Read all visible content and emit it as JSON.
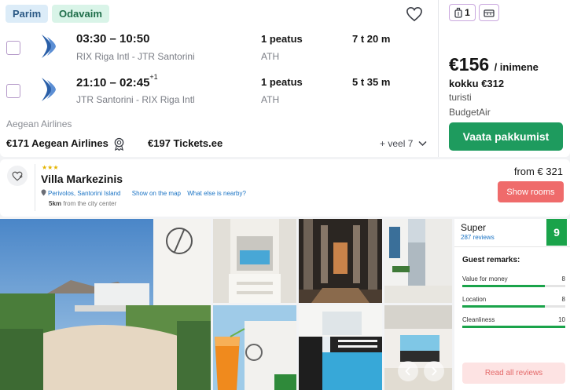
{
  "flight": {
    "badges": {
      "best": "Parim",
      "cheapest": "Odavaim"
    },
    "outbound": {
      "times": "03:30 – 10:50",
      "day_offset": "",
      "route": "RIX Riga Intl - JTR Santorini",
      "stops": "1 peatus",
      "via": "ATH",
      "duration": "7 t 20 m"
    },
    "inbound": {
      "times": "21:10 – 02:45",
      "day_offset": "+1",
      "route": "JTR Santorini - RIX Riga Intl",
      "stops": "1 peatus",
      "via": "ATH",
      "duration": "5 t 35 m"
    },
    "airline": "Aegean Airlines",
    "alternatives": [
      {
        "price": "€171",
        "provider": "Aegean Airlines"
      },
      {
        "price": "€197",
        "provider": "Tickets.ee"
      }
    ],
    "more_label": "+ veel 7",
    "baggage_count": "1",
    "price": "€156",
    "per_person": "/ inimene",
    "total_label": "kokku",
    "total_value": "€312",
    "cabin": "turisti",
    "provider": "BudgetAir",
    "cta_label": "Vaata pakkumist",
    "colors": {
      "cta": "#1e9b5e",
      "accent": "#b59ac9",
      "badge_best": "#dcecf8",
      "badge_cheap": "#d9f4e8"
    }
  },
  "hotel": {
    "stars": "★★★",
    "name": "Villa Markezinis",
    "location": "Perivolos, Santorini Island",
    "map_link": "Show on the map",
    "nearby_link": "What else is nearby?",
    "distance_value": "5km",
    "distance_label": "from the city center",
    "from_label": "from € 321",
    "show_rooms_label": "Show rooms",
    "rating_word": "Super",
    "review_count": "287 reviews",
    "score": "9",
    "remarks_title": "Guest remarks:",
    "metrics": [
      {
        "label": "Value for money",
        "value": "8",
        "fill": 0.8
      },
      {
        "label": "Location",
        "value": "8",
        "fill": 0.8
      },
      {
        "label": "Cleanliness",
        "value": "10",
        "fill": 1.0
      }
    ],
    "read_reviews_label": "Read all reviews",
    "colors": {
      "score": "#1aa34a",
      "show_rooms": "#ef6b6b",
      "link": "#1a73c4"
    }
  }
}
